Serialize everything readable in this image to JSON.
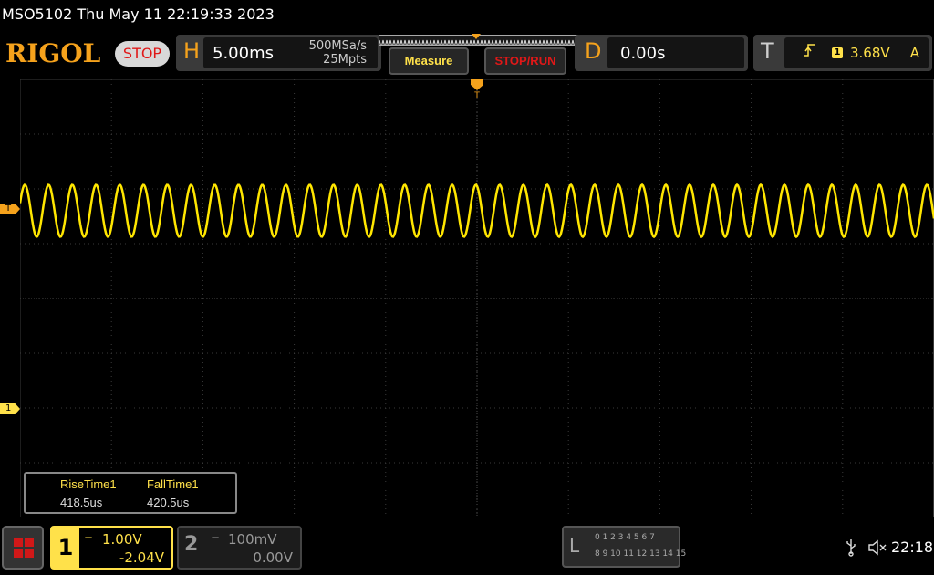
{
  "header": {
    "model_datetime": "MSO5102  Thu May 11 22:19:33 2023",
    "logo": "RIGOL",
    "run_state": "STOP"
  },
  "horizontal": {
    "letter": "H",
    "timebase": "5.00ms",
    "sample_rate": "500MSa/s",
    "memory_depth": "25Mpts"
  },
  "buttons": {
    "measure": "Measure",
    "stop_run": "STOP/RUN"
  },
  "delay": {
    "letter": "D",
    "value": "0.00s"
  },
  "trigger": {
    "letter": "T",
    "source": "1",
    "level": "3.68V",
    "mode": "A"
  },
  "markers": {
    "trigger_level": "T",
    "ch1_ground": "1"
  },
  "measurements": [
    {
      "label": "RiseTime1",
      "value": "418.5us"
    },
    {
      "label": "FallTime1",
      "value": "420.5us"
    }
  ],
  "channels": {
    "ch1": {
      "number": "1",
      "scale": "1.00V",
      "offset": "-2.04V",
      "color": "#ffe14a"
    },
    "ch2": {
      "number": "2",
      "scale": "100mV",
      "offset": "0.00V",
      "color": "#999999"
    }
  },
  "logic": {
    "letter": "L",
    "row1": "0 1 2 3   4 5 6 7",
    "row2": "8 9 10 11  12 13 14 15"
  },
  "status": {
    "time": "22:18"
  },
  "waveform": {
    "cycles_on_screen": 38.5,
    "amplitude_divs": 0.95,
    "center_div_from_top": 2.4,
    "color": "#ffe600"
  }
}
